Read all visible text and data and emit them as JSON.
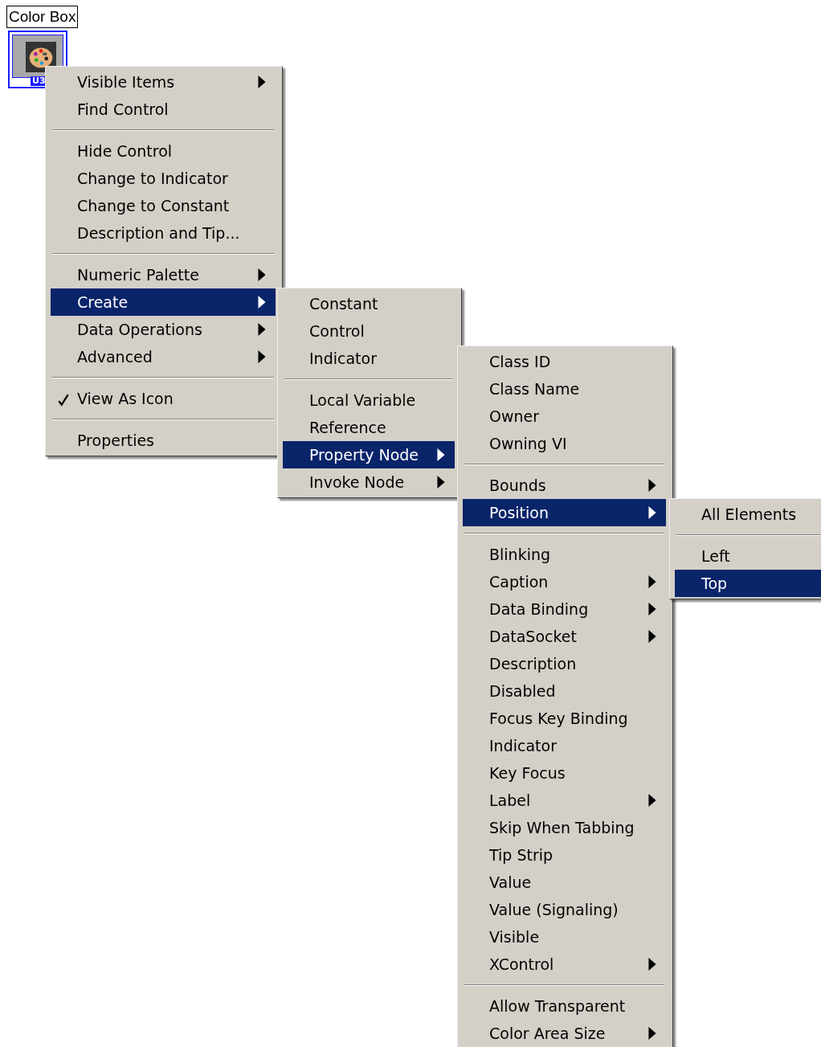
{
  "control": {
    "label": "Color Box",
    "terminal_label": "U3"
  },
  "menus": [
    {
      "items": [
        {
          "kind": "item",
          "label": "Visible Items",
          "submenu": true,
          "selected": false,
          "checked": false
        },
        {
          "kind": "item",
          "label": "Find Control",
          "submenu": false,
          "selected": false,
          "checked": false
        },
        {
          "kind": "separator"
        },
        {
          "kind": "item",
          "label": "Hide Control",
          "submenu": false,
          "selected": false,
          "checked": false
        },
        {
          "kind": "item",
          "label": "Change to Indicator",
          "submenu": false,
          "selected": false,
          "checked": false
        },
        {
          "kind": "item",
          "label": "Change to Constant",
          "submenu": false,
          "selected": false,
          "checked": false
        },
        {
          "kind": "item",
          "label": "Description and Tip...",
          "submenu": false,
          "selected": false,
          "checked": false
        },
        {
          "kind": "separator"
        },
        {
          "kind": "item",
          "label": "Numeric Palette",
          "submenu": true,
          "selected": false,
          "checked": false
        },
        {
          "kind": "item",
          "label": "Create",
          "submenu": true,
          "selected": true,
          "checked": false
        },
        {
          "kind": "item",
          "label": "Data Operations",
          "submenu": true,
          "selected": false,
          "checked": false
        },
        {
          "kind": "item",
          "label": "Advanced",
          "submenu": true,
          "selected": false,
          "checked": false
        },
        {
          "kind": "separator"
        },
        {
          "kind": "item",
          "label": "View As Icon",
          "submenu": false,
          "selected": false,
          "checked": true
        },
        {
          "kind": "separator"
        },
        {
          "kind": "item",
          "label": "Properties",
          "submenu": false,
          "selected": false,
          "checked": false
        }
      ]
    },
    {
      "items": [
        {
          "kind": "item",
          "label": "Constant",
          "submenu": false,
          "selected": false,
          "checked": false
        },
        {
          "kind": "item",
          "label": "Control",
          "submenu": false,
          "selected": false,
          "checked": false
        },
        {
          "kind": "item",
          "label": "Indicator",
          "submenu": false,
          "selected": false,
          "checked": false
        },
        {
          "kind": "separator"
        },
        {
          "kind": "item",
          "label": "Local Variable",
          "submenu": false,
          "selected": false,
          "checked": false
        },
        {
          "kind": "item",
          "label": "Reference",
          "submenu": false,
          "selected": false,
          "checked": false
        },
        {
          "kind": "item",
          "label": "Property Node",
          "submenu": true,
          "selected": true,
          "checked": false
        },
        {
          "kind": "item",
          "label": "Invoke Node",
          "submenu": true,
          "selected": false,
          "checked": false
        }
      ]
    },
    {
      "items": [
        {
          "kind": "item",
          "label": "Class ID",
          "submenu": false,
          "selected": false,
          "checked": false
        },
        {
          "kind": "item",
          "label": "Class Name",
          "submenu": false,
          "selected": false,
          "checked": false
        },
        {
          "kind": "item",
          "label": "Owner",
          "submenu": false,
          "selected": false,
          "checked": false
        },
        {
          "kind": "item",
          "label": "Owning VI",
          "submenu": false,
          "selected": false,
          "checked": false
        },
        {
          "kind": "separator"
        },
        {
          "kind": "item",
          "label": "Bounds",
          "submenu": true,
          "selected": false,
          "checked": false
        },
        {
          "kind": "item",
          "label": "Position",
          "submenu": true,
          "selected": true,
          "checked": false
        },
        {
          "kind": "separator"
        },
        {
          "kind": "item",
          "label": "Blinking",
          "submenu": false,
          "selected": false,
          "checked": false
        },
        {
          "kind": "item",
          "label": "Caption",
          "submenu": true,
          "selected": false,
          "checked": false
        },
        {
          "kind": "item",
          "label": "Data Binding",
          "submenu": true,
          "selected": false,
          "checked": false
        },
        {
          "kind": "item",
          "label": "DataSocket",
          "submenu": true,
          "selected": false,
          "checked": false
        },
        {
          "kind": "item",
          "label": "Description",
          "submenu": false,
          "selected": false,
          "checked": false
        },
        {
          "kind": "item",
          "label": "Disabled",
          "submenu": false,
          "selected": false,
          "checked": false
        },
        {
          "kind": "item",
          "label": "Focus Key Binding",
          "submenu": false,
          "selected": false,
          "checked": false
        },
        {
          "kind": "item",
          "label": "Indicator",
          "submenu": false,
          "selected": false,
          "checked": false
        },
        {
          "kind": "item",
          "label": "Key Focus",
          "submenu": false,
          "selected": false,
          "checked": false
        },
        {
          "kind": "item",
          "label": "Label",
          "submenu": true,
          "selected": false,
          "checked": false
        },
        {
          "kind": "item",
          "label": "Skip When Tabbing",
          "submenu": false,
          "selected": false,
          "checked": false
        },
        {
          "kind": "item",
          "label": "Tip Strip",
          "submenu": false,
          "selected": false,
          "checked": false
        },
        {
          "kind": "item",
          "label": "Value",
          "submenu": false,
          "selected": false,
          "checked": false
        },
        {
          "kind": "item",
          "label": "Value (Signaling)",
          "submenu": false,
          "selected": false,
          "checked": false
        },
        {
          "kind": "item",
          "label": "Visible",
          "submenu": false,
          "selected": false,
          "checked": false
        },
        {
          "kind": "item",
          "label": "XControl",
          "submenu": true,
          "selected": false,
          "checked": false
        },
        {
          "kind": "separator"
        },
        {
          "kind": "item",
          "label": "Allow Transparent",
          "submenu": false,
          "selected": false,
          "checked": false
        },
        {
          "kind": "item",
          "label": "Color Area Size",
          "submenu": true,
          "selected": false,
          "checked": false
        }
      ]
    },
    {
      "items": [
        {
          "kind": "item",
          "label": "All Elements",
          "submenu": false,
          "selected": false,
          "checked": false
        },
        {
          "kind": "separator"
        },
        {
          "kind": "item",
          "label": "Left",
          "submenu": false,
          "selected": false,
          "checked": false
        },
        {
          "kind": "item",
          "label": "Top",
          "submenu": false,
          "selected": true,
          "checked": false
        }
      ]
    }
  ]
}
